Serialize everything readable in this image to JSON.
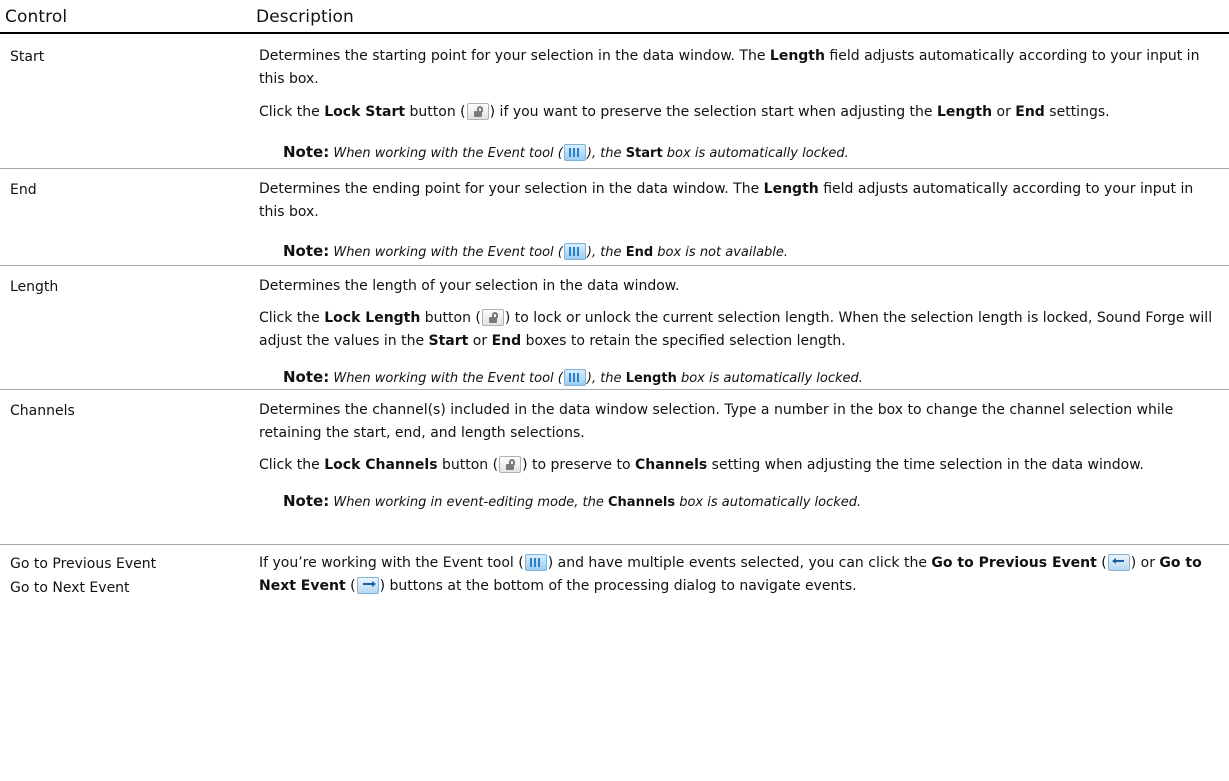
{
  "header": {
    "control": "Control",
    "description": "Description"
  },
  "rows": {
    "start": {
      "control": "Start",
      "p1": {
        "a": "Determines the starting point for your selection in the data window. The ",
        "b1": "Length",
        "c": " field adjusts automatically according to your input in this box."
      },
      "p2": {
        "a": "Click the ",
        "b1": "Lock Start",
        "c": " button (",
        "icon": "lock-icon",
        "d": ") if you want to preserve the selection start when adjusting the ",
        "b2": "Length",
        "e": " or ",
        "b3": "End",
        "f": " settings."
      },
      "note": {
        "label": "Note:",
        "a": " When working with the Event tool (",
        "icon": "event-tool-icon",
        "b": "), the ",
        "b1": "Start",
        "c": " box is automatically locked."
      }
    },
    "end": {
      "control": "End",
      "p1": {
        "a": "Determines the ending point for your selection in the data window. The ",
        "b1": "Length",
        "c": " field adjusts automatically according to your input in this box."
      },
      "note": {
        "label": "Note:",
        "a": " When working with the Event tool (",
        "icon": "event-tool-icon",
        "b": "), the ",
        "b1": "End",
        "c": " box is not available."
      }
    },
    "length": {
      "control": "Length",
      "p1": {
        "a": "Determines the length of your selection in the data window."
      },
      "p2": {
        "a": "Click the ",
        "b1": "Lock Length",
        "c": " button (",
        "icon": "lock-icon",
        "d": ") to lock or unlock the current selection length. When the selection length is locked, Sound Forge will adjust the values in the ",
        "b2": "Start",
        "e": " or ",
        "b3": "End",
        "f": " boxes to retain the specified selection length."
      },
      "note": {
        "label": "Note:",
        "a": " When working with the Event tool (",
        "icon": "event-tool-icon",
        "b": "), the ",
        "b1": "Length",
        "c": " box is automatically locked."
      }
    },
    "channels": {
      "control": "Channels",
      "p1": {
        "a": "Determines the channel(s) included in the data window selection. Type a number in the box to change the channel selection while retaining the start, end, and length selections."
      },
      "p2": {
        "a": "Click the ",
        "b1": "Lock Channels",
        "c": " button (",
        "icon": "lock-icon",
        "d": ") to preserve to ",
        "b2": "Channels",
        "e": " setting when adjusting the time selection in the data window."
      },
      "note": {
        "label": "Note:",
        "a": " When working in event-editing mode, the ",
        "b1": "Channels",
        "c": " box is automatically locked."
      }
    },
    "goto": {
      "control1": "Go to Previous Event",
      "control2": "Go to Next Event",
      "p1": {
        "a": "If you’re working with the Event tool (",
        "icon1": "event-tool-icon",
        "b": ") and have multiple events selected, you can click the ",
        "b1": "Go to Previous Event",
        "c": " (",
        "icon2": "previous-event-icon",
        "d": ") or ",
        "b2": "Go to Next Event",
        "e": " (",
        "icon3": "next-event-icon",
        "f": ") buttons at the bottom of the processing dialog to navigate events."
      }
    }
  }
}
